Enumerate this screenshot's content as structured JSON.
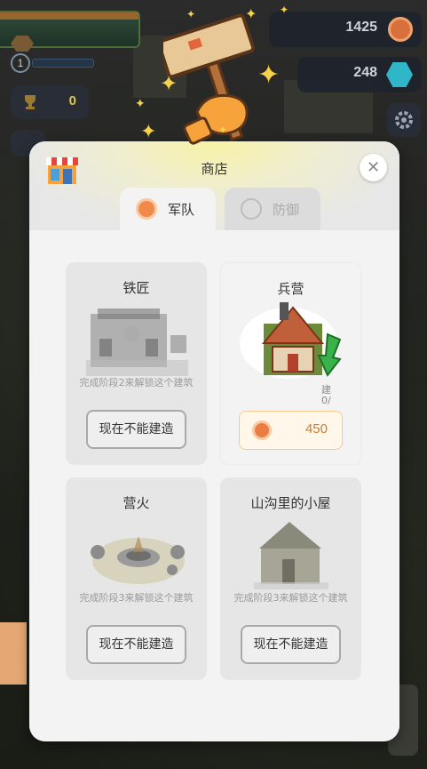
{
  "hud": {
    "level": "1",
    "trophies": "0",
    "coins": "1425",
    "gems": "248"
  },
  "shop": {
    "title": "商店",
    "tabs": [
      {
        "label": "军队",
        "active": true
      },
      {
        "label": "防御",
        "active": false
      }
    ],
    "cards": [
      {
        "name": "铁匠",
        "lock_text": "完成阶段2来解锁这个建筑",
        "button": "现在不能建造",
        "available": false
      },
      {
        "name": "兵营",
        "price": "450",
        "count_text": "0/",
        "peek_text": "建",
        "available": true
      },
      {
        "name": "营火",
        "lock_text": "完成阶段3来解锁这个建筑",
        "button": "现在不能建造",
        "available": false
      },
      {
        "name": "山沟里的小屋",
        "lock_text": "完成阶段3来解锁这个建筑",
        "button": "现在不能建造",
        "available": false
      }
    ]
  },
  "icons": {
    "close": "close-icon",
    "shop": "shop-icon",
    "coin": "coin-icon",
    "gem": "gem-icon",
    "settings": "gear-icon",
    "hammer": "hammer-icon",
    "trophy": "trophy-icon"
  },
  "colors": {
    "accent_orange": "#e97d43",
    "price_text": "#d07a2e",
    "gem": "#2fb7c9",
    "trophy": "#e2c64e"
  }
}
